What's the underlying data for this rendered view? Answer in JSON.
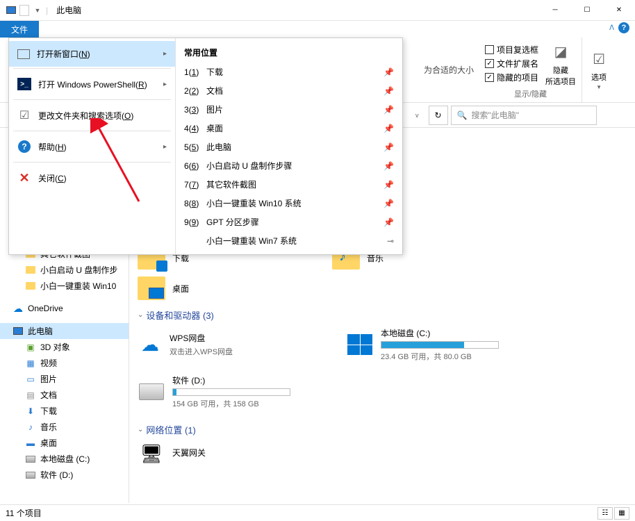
{
  "title": "此电脑",
  "hidden_size_text": "为合适的大小",
  "ribbon": {
    "file_tab": "文件",
    "checkboxes": {
      "item_checkbox": "项目复选框",
      "filename_ext": "文件扩展名",
      "hidden_items": "隐藏的项目"
    },
    "hide_selected": "隐藏\n所选项目",
    "options": "选项",
    "group_label": "显示/隐藏"
  },
  "search": {
    "placeholder": "搜索\"此电脑\""
  },
  "file_menu": {
    "open_new_window": "打开新窗口(N)",
    "open_powershell": "打开 Windows PowerShell(R)",
    "change_options": "更改文件夹和搜索选项(O)",
    "help": "帮助(H)",
    "close": "关闭(C)",
    "recent_header": "常用位置",
    "recent": [
      {
        "num": "1(1)",
        "label": "下载",
        "pinned": true
      },
      {
        "num": "2(2)",
        "label": "文档",
        "pinned": true
      },
      {
        "num": "3(3)",
        "label": "图片",
        "pinned": true
      },
      {
        "num": "4(4)",
        "label": "桌面",
        "pinned": true
      },
      {
        "num": "5(5)",
        "label": "此电脑",
        "pinned": true
      },
      {
        "num": "6(6)",
        "label": "小白启动 U 盘制作步骤",
        "pinned": true
      },
      {
        "num": "7(7)",
        "label": "其它软件截图",
        "pinned": true
      },
      {
        "num": "8(8)",
        "label": "小白一键重装 Win10 系统",
        "pinned": true
      },
      {
        "num": "9(9)",
        "label": "GPT 分区步骤",
        "pinned": true
      },
      {
        "num": "",
        "label": "小白一键重装 Win7 系统",
        "pinned": false
      }
    ]
  },
  "sidebar": {
    "items": [
      {
        "label": "其它软件截图",
        "type": "folder"
      },
      {
        "label": "小白启动 U 盘制作步",
        "type": "folder"
      },
      {
        "label": "小白一键重装 Win10",
        "type": "folder"
      }
    ],
    "onedrive": "OneDrive",
    "thispc": "此电脑",
    "pc_items": [
      {
        "label": "3D 对象",
        "icon": "3d"
      },
      {
        "label": "视频",
        "icon": "video"
      },
      {
        "label": "图片",
        "icon": "pic"
      },
      {
        "label": "文档",
        "icon": "doc"
      },
      {
        "label": "下载",
        "icon": "dl"
      },
      {
        "label": "音乐",
        "icon": "music"
      },
      {
        "label": "桌面",
        "icon": "desktop"
      },
      {
        "label": "本地磁盘 (C:)",
        "icon": "drive"
      },
      {
        "label": "软件 (D:)",
        "icon": "drive"
      }
    ]
  },
  "content": {
    "folders": [
      {
        "label": "下载",
        "variant": "dl"
      },
      {
        "label": "音乐",
        "variant": "music"
      },
      {
        "label": "桌面",
        "variant": "desktop"
      }
    ],
    "devices_header": "设备和驱动器 (3)",
    "wps": {
      "name": "WPS网盘",
      "sub": "双击进入WPS网盘"
    },
    "drive_c": {
      "name": "本地磁盘 (C:)",
      "info": "23.4 GB 可用，共 80.0 GB",
      "pct": 71
    },
    "drive_d": {
      "name": "软件 (D:)",
      "info": "154 GB 可用，共 158 GB",
      "pct": 3
    },
    "network_header": "网络位置 (1)",
    "gateway": "天翼网关"
  },
  "status": {
    "count": "11 个项目"
  }
}
